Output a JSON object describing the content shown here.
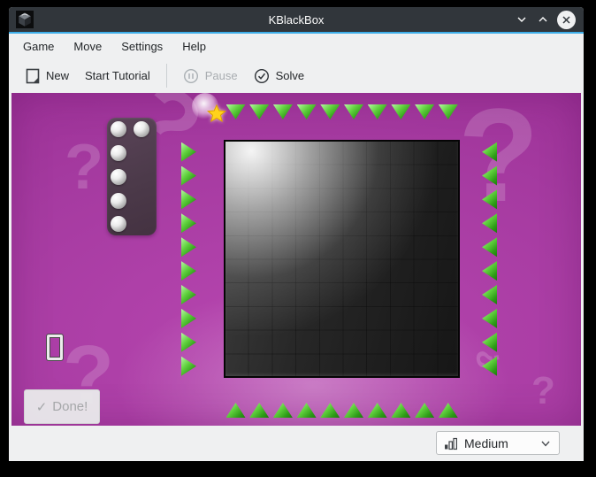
{
  "window": {
    "title": "KBlackBox"
  },
  "menubar": {
    "items": [
      {
        "label": "Game"
      },
      {
        "label": "Move"
      },
      {
        "label": "Settings"
      },
      {
        "label": "Help"
      }
    ]
  },
  "toolbar": {
    "buttons": [
      {
        "label": "New",
        "icon": "new-document-icon",
        "enabled": true
      },
      {
        "label": "Start Tutorial",
        "icon": null,
        "enabled": true
      },
      {
        "label": "Pause",
        "icon": "pause-icon",
        "enabled": false
      },
      {
        "label": "Solve",
        "icon": "check-circle-icon",
        "enabled": true
      }
    ]
  },
  "board": {
    "columns": 10,
    "rows": 10,
    "top_arrows": 10,
    "bottom_arrows": 10,
    "left_arrows": 10,
    "right_arrows": 10
  },
  "holder": {
    "ball_count": 6
  },
  "game": {
    "done_button": {
      "check_glyph": "✓",
      "label": "Done!",
      "enabled": false
    },
    "decoration_glyph": "?"
  },
  "statusbar": {
    "difficulty": {
      "value": "Medium",
      "icon": "difficulty-bars-icon"
    }
  },
  "colors": {
    "accent_blue": "#3daee9",
    "titlebar": "#31363b",
    "chrome_bg": "#eff0f1",
    "game_purple": "#a53aa0",
    "arrow_green": "#3fae2a",
    "star_yellow": "#ffd21c"
  }
}
